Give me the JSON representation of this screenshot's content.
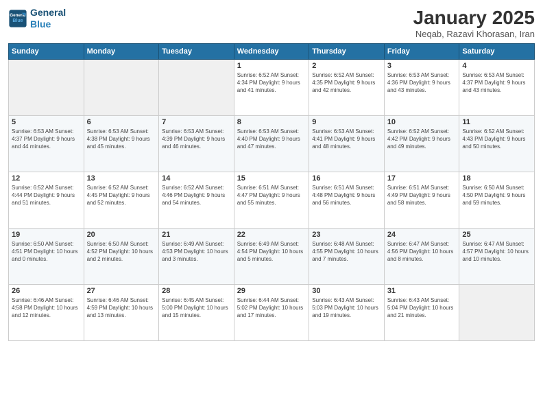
{
  "app": {
    "logo_line1": "General",
    "logo_line2": "Blue"
  },
  "calendar": {
    "title": "January 2025",
    "subtitle": "Neqab, Razavi Khorasan, Iran",
    "days_of_week": [
      "Sunday",
      "Monday",
      "Tuesday",
      "Wednesday",
      "Thursday",
      "Friday",
      "Saturday"
    ],
    "weeks": [
      [
        {
          "day": "",
          "info": ""
        },
        {
          "day": "",
          "info": ""
        },
        {
          "day": "",
          "info": ""
        },
        {
          "day": "1",
          "info": "Sunrise: 6:52 AM\nSunset: 4:34 PM\nDaylight: 9 hours\nand 41 minutes."
        },
        {
          "day": "2",
          "info": "Sunrise: 6:52 AM\nSunset: 4:35 PM\nDaylight: 9 hours\nand 42 minutes."
        },
        {
          "day": "3",
          "info": "Sunrise: 6:53 AM\nSunset: 4:36 PM\nDaylight: 9 hours\nand 43 minutes."
        },
        {
          "day": "4",
          "info": "Sunrise: 6:53 AM\nSunset: 4:37 PM\nDaylight: 9 hours\nand 43 minutes."
        }
      ],
      [
        {
          "day": "5",
          "info": "Sunrise: 6:53 AM\nSunset: 4:37 PM\nDaylight: 9 hours\nand 44 minutes."
        },
        {
          "day": "6",
          "info": "Sunrise: 6:53 AM\nSunset: 4:38 PM\nDaylight: 9 hours\nand 45 minutes."
        },
        {
          "day": "7",
          "info": "Sunrise: 6:53 AM\nSunset: 4:39 PM\nDaylight: 9 hours\nand 46 minutes."
        },
        {
          "day": "8",
          "info": "Sunrise: 6:53 AM\nSunset: 4:40 PM\nDaylight: 9 hours\nand 47 minutes."
        },
        {
          "day": "9",
          "info": "Sunrise: 6:53 AM\nSunset: 4:41 PM\nDaylight: 9 hours\nand 48 minutes."
        },
        {
          "day": "10",
          "info": "Sunrise: 6:52 AM\nSunset: 4:42 PM\nDaylight: 9 hours\nand 49 minutes."
        },
        {
          "day": "11",
          "info": "Sunrise: 6:52 AM\nSunset: 4:43 PM\nDaylight: 9 hours\nand 50 minutes."
        }
      ],
      [
        {
          "day": "12",
          "info": "Sunrise: 6:52 AM\nSunset: 4:44 PM\nDaylight: 9 hours\nand 51 minutes."
        },
        {
          "day": "13",
          "info": "Sunrise: 6:52 AM\nSunset: 4:45 PM\nDaylight: 9 hours\nand 52 minutes."
        },
        {
          "day": "14",
          "info": "Sunrise: 6:52 AM\nSunset: 4:46 PM\nDaylight: 9 hours\nand 54 minutes."
        },
        {
          "day": "15",
          "info": "Sunrise: 6:51 AM\nSunset: 4:47 PM\nDaylight: 9 hours\nand 55 minutes."
        },
        {
          "day": "16",
          "info": "Sunrise: 6:51 AM\nSunset: 4:48 PM\nDaylight: 9 hours\nand 56 minutes."
        },
        {
          "day": "17",
          "info": "Sunrise: 6:51 AM\nSunset: 4:49 PM\nDaylight: 9 hours\nand 58 minutes."
        },
        {
          "day": "18",
          "info": "Sunrise: 6:50 AM\nSunset: 4:50 PM\nDaylight: 9 hours\nand 59 minutes."
        }
      ],
      [
        {
          "day": "19",
          "info": "Sunrise: 6:50 AM\nSunset: 4:51 PM\nDaylight: 10 hours\nand 0 minutes."
        },
        {
          "day": "20",
          "info": "Sunrise: 6:50 AM\nSunset: 4:52 PM\nDaylight: 10 hours\nand 2 minutes."
        },
        {
          "day": "21",
          "info": "Sunrise: 6:49 AM\nSunset: 4:53 PM\nDaylight: 10 hours\nand 3 minutes."
        },
        {
          "day": "22",
          "info": "Sunrise: 6:49 AM\nSunset: 4:54 PM\nDaylight: 10 hours\nand 5 minutes."
        },
        {
          "day": "23",
          "info": "Sunrise: 6:48 AM\nSunset: 4:55 PM\nDaylight: 10 hours\nand 7 minutes."
        },
        {
          "day": "24",
          "info": "Sunrise: 6:47 AM\nSunset: 4:56 PM\nDaylight: 10 hours\nand 8 minutes."
        },
        {
          "day": "25",
          "info": "Sunrise: 6:47 AM\nSunset: 4:57 PM\nDaylight: 10 hours\nand 10 minutes."
        }
      ],
      [
        {
          "day": "26",
          "info": "Sunrise: 6:46 AM\nSunset: 4:58 PM\nDaylight: 10 hours\nand 12 minutes."
        },
        {
          "day": "27",
          "info": "Sunrise: 6:46 AM\nSunset: 4:59 PM\nDaylight: 10 hours\nand 13 minutes."
        },
        {
          "day": "28",
          "info": "Sunrise: 6:45 AM\nSunset: 5:00 PM\nDaylight: 10 hours\nand 15 minutes."
        },
        {
          "day": "29",
          "info": "Sunrise: 6:44 AM\nSunset: 5:02 PM\nDaylight: 10 hours\nand 17 minutes."
        },
        {
          "day": "30",
          "info": "Sunrise: 6:43 AM\nSunset: 5:03 PM\nDaylight: 10 hours\nand 19 minutes."
        },
        {
          "day": "31",
          "info": "Sunrise: 6:43 AM\nSunset: 5:04 PM\nDaylight: 10 hours\nand 21 minutes."
        },
        {
          "day": "",
          "info": ""
        }
      ]
    ]
  }
}
